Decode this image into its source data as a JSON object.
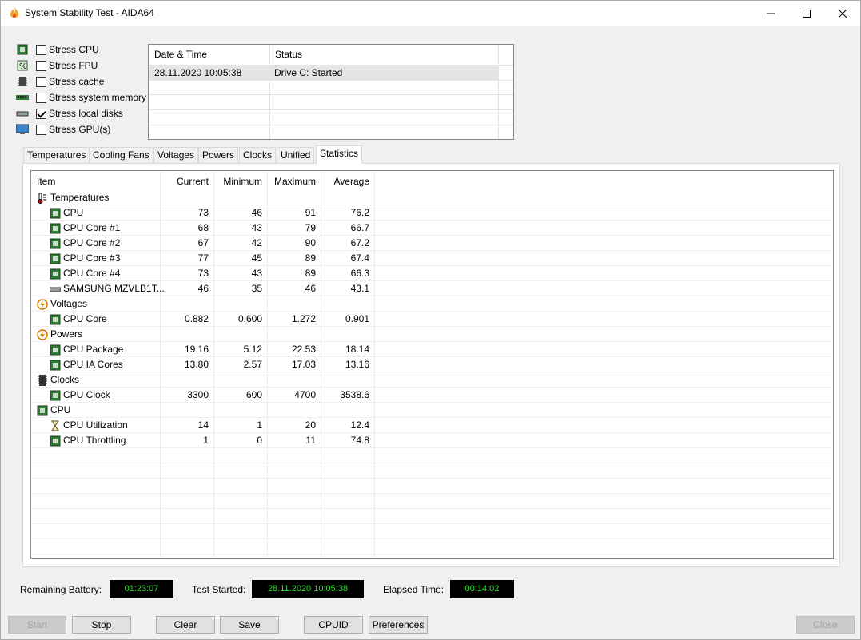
{
  "window": {
    "title": "System Stability Test - AIDA64"
  },
  "stress": [
    {
      "label": "Stress CPU",
      "checked": false,
      "icon": "cpu-chip-icon"
    },
    {
      "label": "Stress FPU",
      "checked": false,
      "icon": "fpu-percent-icon"
    },
    {
      "label": "Stress cache",
      "checked": false,
      "icon": "cache-icon"
    },
    {
      "label": "Stress system memory",
      "checked": false,
      "icon": "memory-module-icon"
    },
    {
      "label": "Stress local disks",
      "checked": true,
      "icon": "disk-drive-icon"
    },
    {
      "label": "Stress GPU(s)",
      "checked": false,
      "icon": "monitor-icon"
    }
  ],
  "log": {
    "headers": [
      "Date & Time",
      "Status"
    ],
    "rows": [
      {
        "datetime": "28.11.2020 10:05:38",
        "status": "Drive C: Started"
      }
    ]
  },
  "tabs": [
    "Temperatures",
    "Cooling Fans",
    "Voltages",
    "Powers",
    "Clocks",
    "Unified",
    "Statistics"
  ],
  "active_tab": "Statistics",
  "stats": {
    "headers": {
      "item": "Item",
      "current": "Current",
      "minimum": "Minimum",
      "maximum": "Maximum",
      "average": "Average"
    },
    "rows": [
      {
        "type": "group",
        "name": "Temperatures",
        "icon": "thermometer-icon"
      },
      {
        "type": "item",
        "name": "CPU",
        "icon": "cpu-chip-icon",
        "current": "73",
        "minimum": "46",
        "maximum": "91",
        "average": "76.2"
      },
      {
        "type": "item",
        "name": "CPU Core #1",
        "icon": "cpu-chip-icon",
        "current": "68",
        "minimum": "43",
        "maximum": "79",
        "average": "66.7"
      },
      {
        "type": "item",
        "name": "CPU Core #2",
        "icon": "cpu-chip-icon",
        "current": "67",
        "minimum": "42",
        "maximum": "90",
        "average": "67.2"
      },
      {
        "type": "item",
        "name": "CPU Core #3",
        "icon": "cpu-chip-icon",
        "current": "77",
        "minimum": "45",
        "maximum": "89",
        "average": "67.4"
      },
      {
        "type": "item",
        "name": "CPU Core #4",
        "icon": "cpu-chip-icon",
        "current": "73",
        "minimum": "43",
        "maximum": "89",
        "average": "66.3"
      },
      {
        "type": "item",
        "name": "SAMSUNG MZVLB1T...",
        "icon": "disk-drive-icon",
        "current": "46",
        "minimum": "35",
        "maximum": "46",
        "average": "43.1"
      },
      {
        "type": "group",
        "name": "Voltages",
        "icon": "lightning-icon"
      },
      {
        "type": "item",
        "name": "CPU Core",
        "icon": "cpu-chip-icon",
        "current": "0.882",
        "minimum": "0.600",
        "maximum": "1.272",
        "average": "0.901"
      },
      {
        "type": "group",
        "name": "Powers",
        "icon": "lightning-icon"
      },
      {
        "type": "item",
        "name": "CPU Package",
        "icon": "cpu-chip-icon",
        "current": "19.16",
        "minimum": "5.12",
        "maximum": "22.53",
        "average": "18.14"
      },
      {
        "type": "item",
        "name": "CPU IA Cores",
        "icon": "cpu-chip-icon",
        "current": "13.80",
        "minimum": "2.57",
        "maximum": "17.03",
        "average": "13.16"
      },
      {
        "type": "group",
        "name": "Clocks",
        "icon": "clock-chip-icon"
      },
      {
        "type": "item",
        "name": "CPU Clock",
        "icon": "cpu-chip-icon",
        "current": "3300",
        "minimum": "600",
        "maximum": "4700",
        "average": "3538.6"
      },
      {
        "type": "group",
        "name": "CPU",
        "icon": "cpu-chip-icon"
      },
      {
        "type": "item",
        "name": "CPU Utilization",
        "icon": "hourglass-icon",
        "current": "14",
        "minimum": "1",
        "maximum": "20",
        "average": "12.4"
      },
      {
        "type": "item",
        "name": "CPU Throttling",
        "icon": "cpu-chip-icon",
        "current": "1",
        "minimum": "0",
        "maximum": "11",
        "average": "74.8"
      }
    ]
  },
  "info": {
    "battery_label": "Remaining Battery:",
    "battery_value": "01:23:07",
    "started_label": "Test Started:",
    "started_value": "28.11.2020 10:05:38",
    "elapsed_label": "Elapsed Time:",
    "elapsed_value": "00:14:02"
  },
  "buttons": {
    "start": "Start",
    "stop": "Stop",
    "clear": "Clear",
    "save": "Save",
    "cpuid": "CPUID",
    "preferences": "Preferences",
    "close": "Close"
  },
  "colors": {
    "lcd_text": "#22e022",
    "lcd_bg": "#000000",
    "chip_green": "#2e7d32"
  }
}
